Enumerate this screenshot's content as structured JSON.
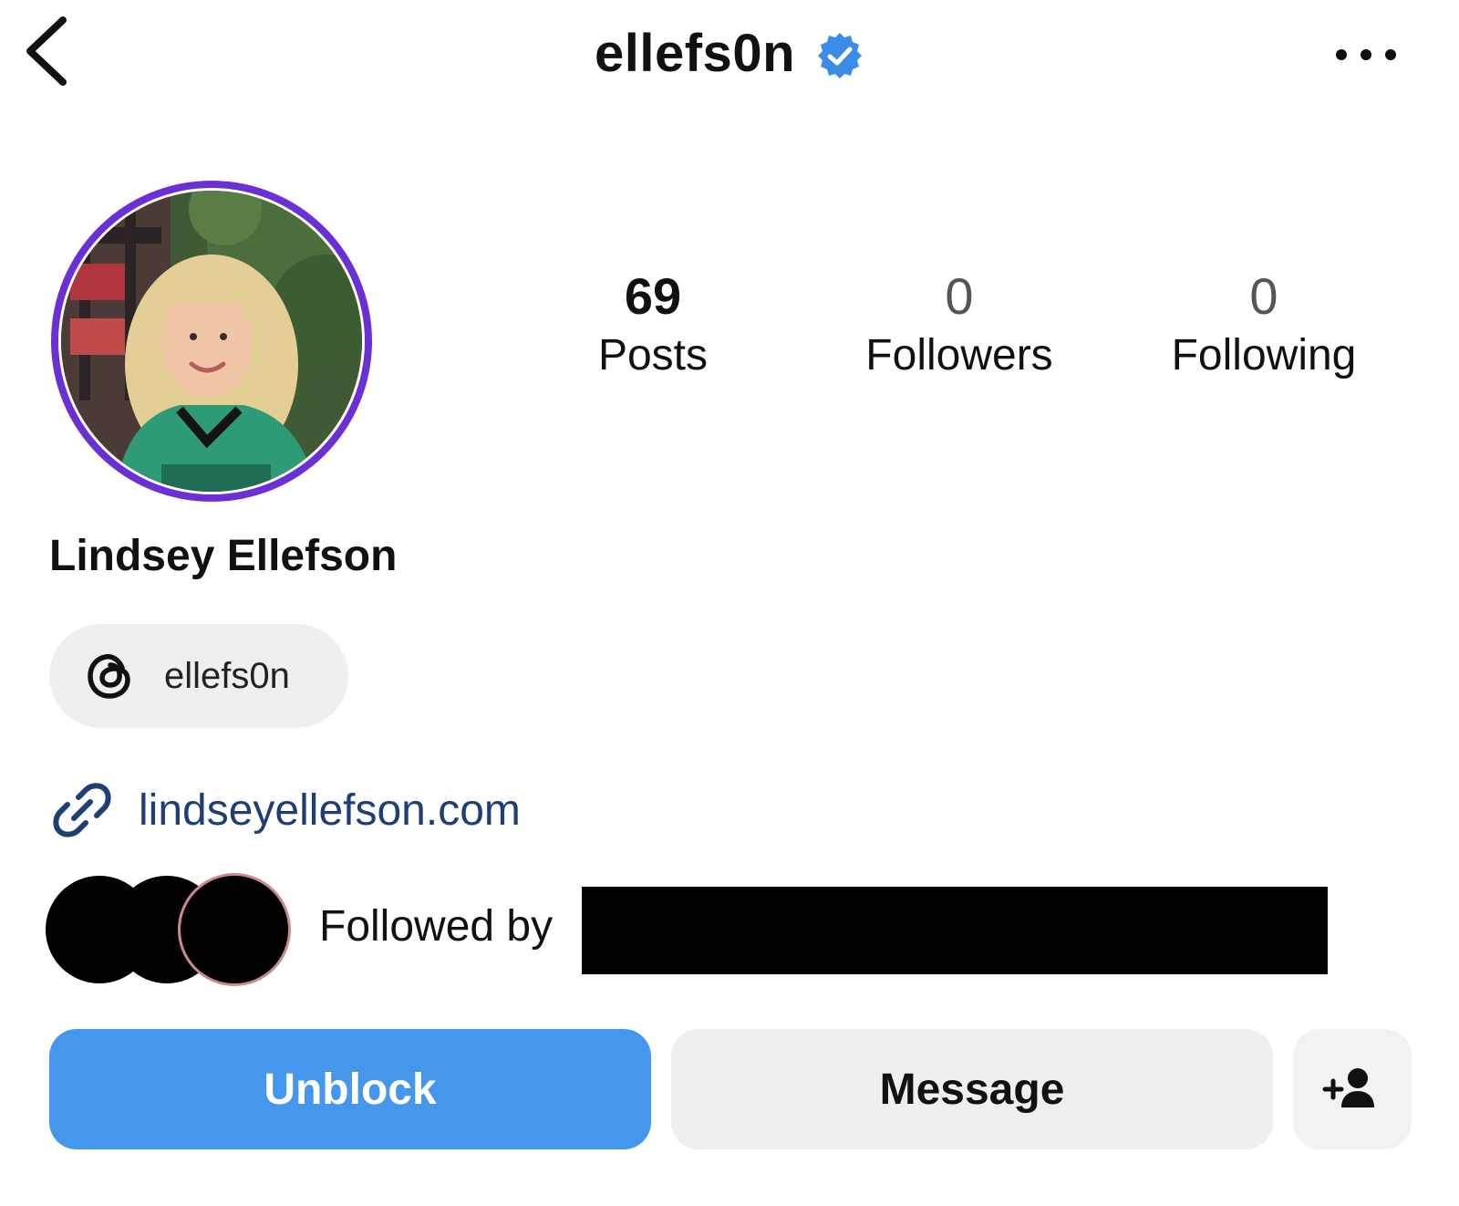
{
  "header": {
    "username": "ellefs0n",
    "verified": true,
    "back_icon": "chevron-left-icon",
    "more_icon": "more-horizontal-icon"
  },
  "profile": {
    "avatar": "profile-photo",
    "avatar_ring_color": "#6b2fd6",
    "full_name": "Lindsey Ellefson"
  },
  "stats": [
    {
      "value": "69",
      "label": "Posts"
    },
    {
      "value": "0",
      "label": "Followers"
    },
    {
      "value": "0",
      "label": "Following"
    }
  ],
  "threads": {
    "icon": "threads-icon",
    "handle": "ellefs0n"
  },
  "link": {
    "icon": "link-icon",
    "text": "lindseyellefson.com",
    "color": "#1f3f74"
  },
  "followed_by": {
    "text": "Followed by"
  },
  "actions": {
    "unblock_label": "Unblock",
    "message_label": "Message",
    "add_icon": "add-person-icon"
  },
  "colors": {
    "primary_button": "#4597ee",
    "secondary_button": "#efefef",
    "verified_badge": "#3b8ce6"
  }
}
